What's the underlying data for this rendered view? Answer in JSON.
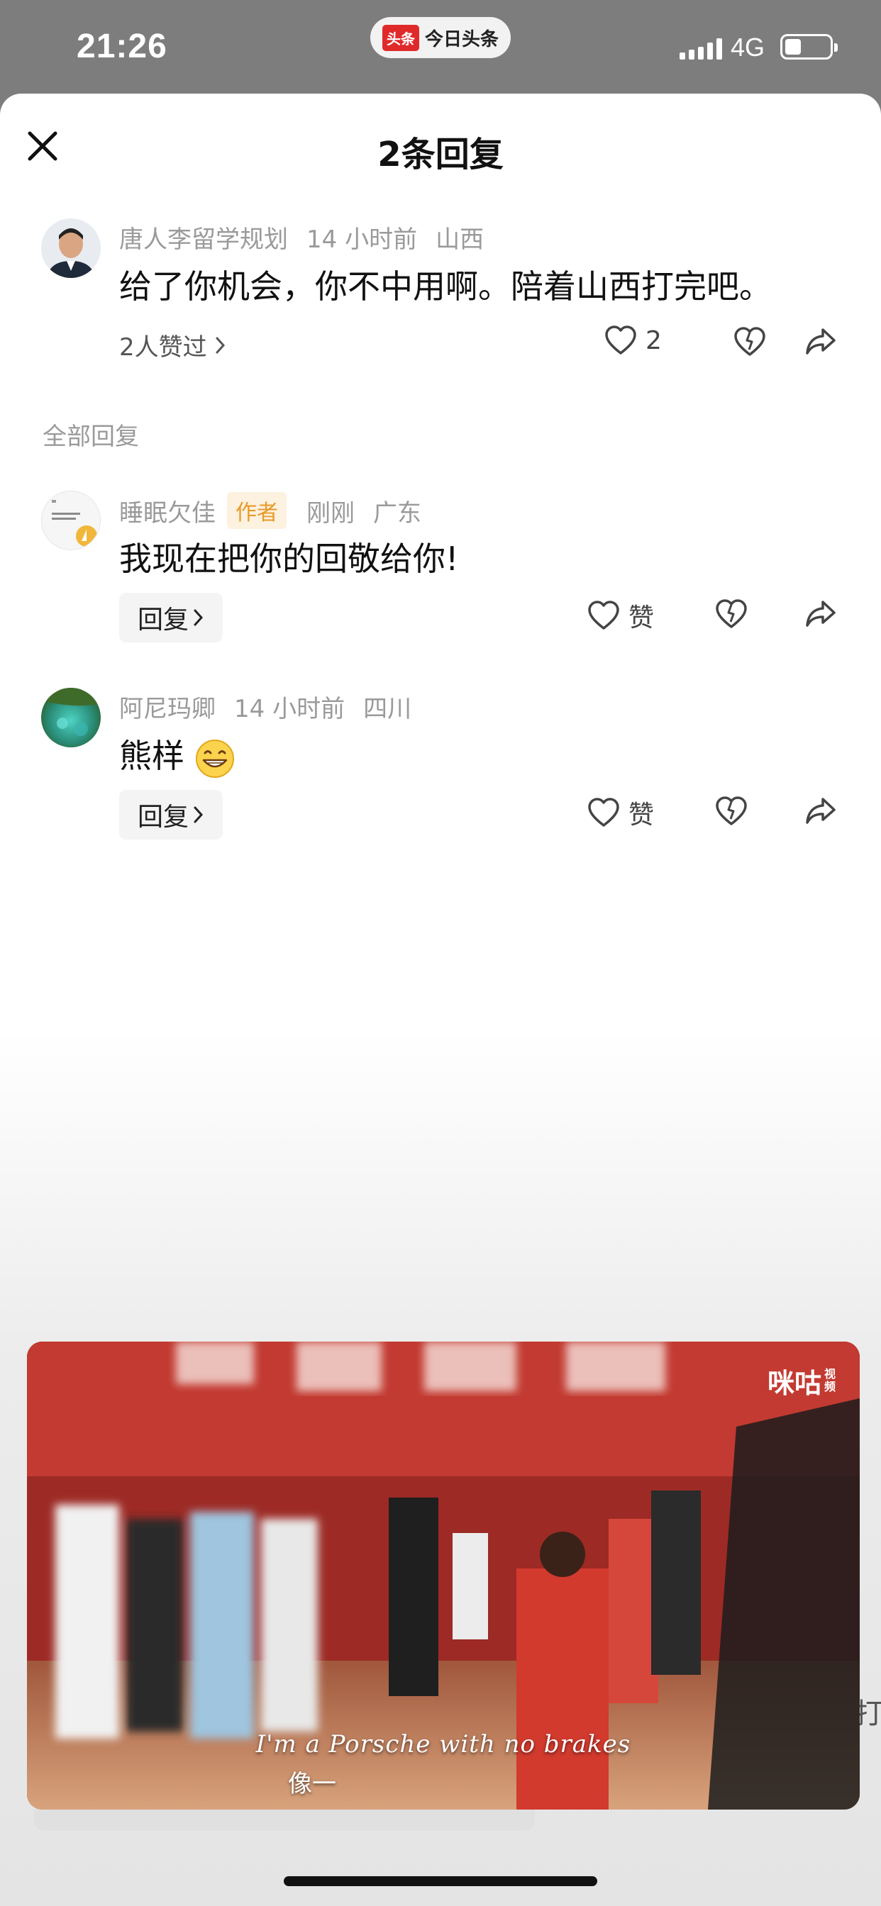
{
  "status_bar": {
    "time": "21:26",
    "app_logo": "头条",
    "app_name": "今日头条",
    "network": "4G",
    "battery_level": 0.35
  },
  "sheet": {
    "title": "2条回复",
    "close_icon": "close-icon"
  },
  "main_comment": {
    "author": "唐人李留学规划",
    "time": "14 小时前",
    "location": "山西",
    "text": "给了你机会，你不中用啊。陪着山西打完吧。",
    "likers": "2人赞过",
    "like_count": "2"
  },
  "section_label": "全部回复",
  "replies": [
    {
      "author": "睡眠欠佳",
      "badge": "作者",
      "time": "刚刚",
      "location": "广东",
      "text": "我现在把你的回敬给你!",
      "reply_label": "回复",
      "like_label": "赞"
    },
    {
      "author": "阿尼玛卿",
      "time": "14 小时前",
      "location": "四川",
      "text": "熊样",
      "reply_label": "回复",
      "like_label": "赞"
    }
  ],
  "video": {
    "watermark": "咪咕",
    "watermark_sub": "视频",
    "subtitle_en": "I'm a Porsche with no brakes",
    "subtitle_zh": "像一"
  },
  "peek_text": "打",
  "colors": {
    "badge_bg": "#fdf1df",
    "badge_text": "#e89a28",
    "video_red": "#b5322c"
  }
}
